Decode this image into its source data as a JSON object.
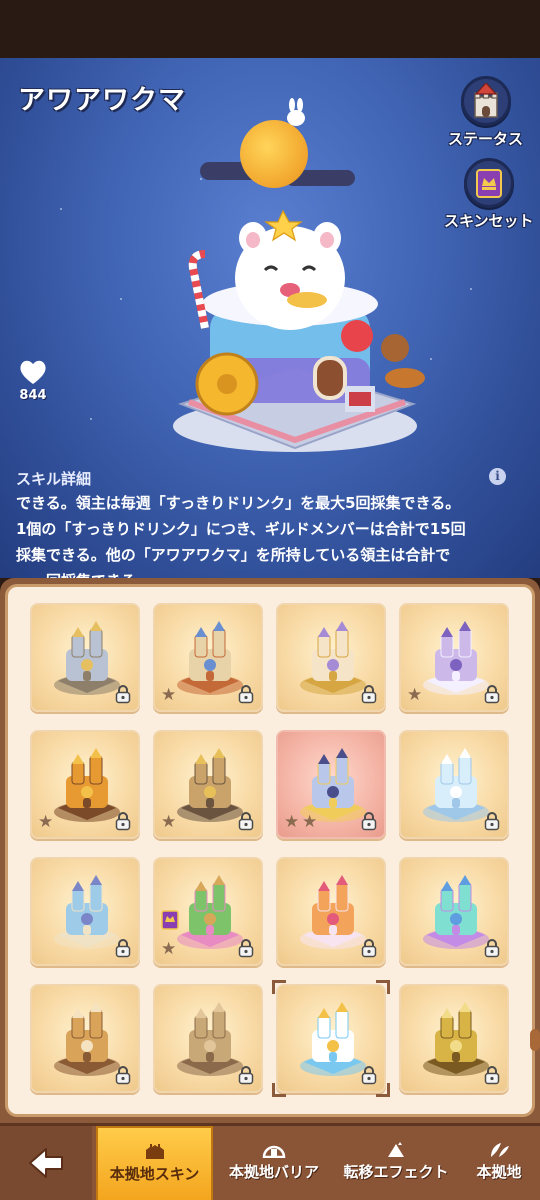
{
  "skin": {
    "name": "アワアワクマ",
    "like_count": "844"
  },
  "side_buttons": {
    "status_label": "ステータス",
    "skinset_label": "スキンセット"
  },
  "skill": {
    "title": "スキル詳細",
    "lines": [
      "できる。領主は毎週「すっきりドリンク」を最大5回採集できる。",
      "1個の「すっきりドリンク」につき、ギルドメンバーは合計で15回",
      "採集できる。他の「アワアワクマ」を所持している領主は合計で",
      "　　回採集できる。"
    ]
  },
  "tabs": {
    "back_icon": "back-arrow-icon",
    "items": [
      {
        "label": "本拠地スキン",
        "active": true
      },
      {
        "label": "本拠地バリア",
        "active": false
      },
      {
        "label": "転移エフェクト",
        "active": false
      },
      {
        "label": "本拠地",
        "active": false
      }
    ]
  },
  "colors": {
    "accent": "#f4a51e",
    "panel": "#fbeede",
    "hero_bg": "#4266b6"
  },
  "skins_grid": [
    {
      "theme": "stone-castle",
      "locked": true,
      "stars": 0,
      "selected": false,
      "tint": "gold"
    },
    {
      "theme": "crab-fortress",
      "locked": true,
      "stars": 1,
      "selected": false,
      "tint": "gold"
    },
    {
      "theme": "dessert-palace",
      "locked": true,
      "stars": 0,
      "selected": false,
      "tint": "gold"
    },
    {
      "theme": "lavender-castle",
      "locked": true,
      "stars": 1,
      "selected": false,
      "tint": "gold"
    },
    {
      "theme": "pumpkin-house",
      "locked": true,
      "stars": 1,
      "selected": false,
      "tint": "gold"
    },
    {
      "theme": "cannon-ship",
      "locked": true,
      "stars": 1,
      "selected": false,
      "tint": "gold"
    },
    {
      "theme": "dragon-shrine",
      "locked": true,
      "stars": 2,
      "selected": false,
      "tint": "pink"
    },
    {
      "theme": "ice-castle",
      "locked": true,
      "stars": 0,
      "selected": false,
      "tint": "gold"
    },
    {
      "theme": "crystal-temple",
      "locked": true,
      "stars": 0,
      "selected": false,
      "tint": "gold"
    },
    {
      "theme": "forest-camp",
      "locked": true,
      "stars": 1,
      "selected": false,
      "tint": "gold",
      "badge": true
    },
    {
      "theme": "candy-house",
      "locked": true,
      "stars": 0,
      "selected": false,
      "tint": "gold"
    },
    {
      "theme": "coral-reef",
      "locked": true,
      "stars": 0,
      "selected": false,
      "tint": "gold"
    },
    {
      "theme": "airship",
      "locked": true,
      "stars": 0,
      "selected": false,
      "tint": "gold"
    },
    {
      "theme": "steam-tower",
      "locked": true,
      "stars": 0,
      "selected": false,
      "tint": "gold"
    },
    {
      "theme": "bubble-bear",
      "locked": true,
      "stars": 0,
      "selected": true,
      "tint": "gold"
    },
    {
      "theme": "golden-dragon",
      "locked": true,
      "stars": 0,
      "selected": false,
      "tint": "gold"
    }
  ]
}
